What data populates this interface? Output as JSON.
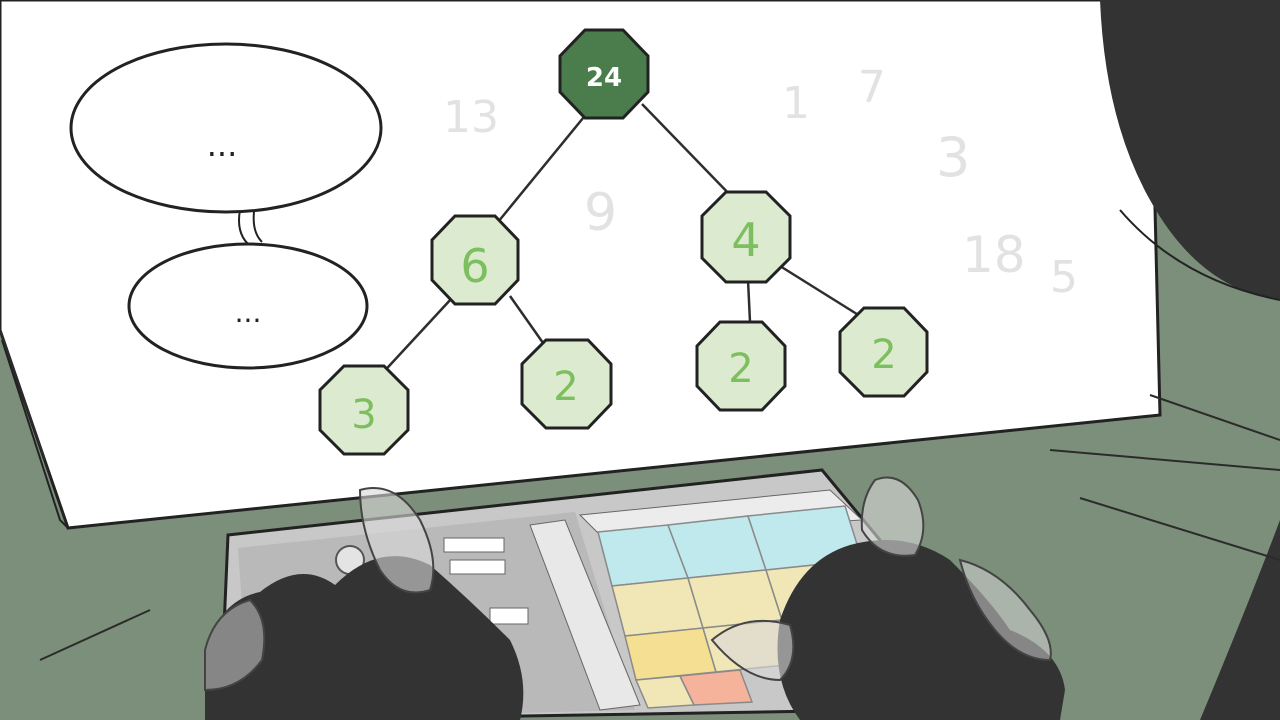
{
  "speech": {
    "top": "...",
    "bottom": "..."
  },
  "tree": {
    "root": "24",
    "left": "6",
    "right": "4",
    "left_left": "3",
    "left_right": "2",
    "right_left": "2",
    "right_right": "2"
  },
  "faint_numbers": [
    "13",
    "9",
    "1",
    "7",
    "3",
    "18",
    "5"
  ],
  "colors": {
    "background": "#7c8f7b",
    "screen": "#ffffff",
    "root_node": "#4a7c4c",
    "node_fill": "#dcebd0",
    "node_text": "#7dbf5f",
    "faint_text": "#e2e2e2",
    "dark_silhouette": "#333333",
    "tile_cyan": "#bfe9ec",
    "tile_yellow": "#f1e6b6",
    "tile_gold": "#f4df93",
    "tile_orange": "#f4b39a"
  }
}
